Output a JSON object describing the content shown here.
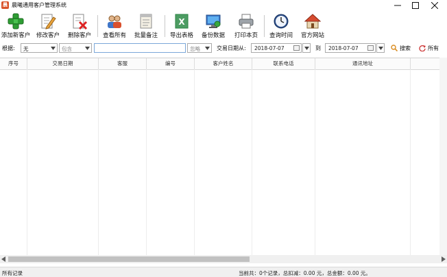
{
  "window": {
    "title": "晨曦通用客户管理系统",
    "app_icon_glyph": "晨"
  },
  "toolbar": {
    "add_customer": "添加新客户",
    "edit_customer": "修改客户",
    "delete_customer": "删除客户",
    "view_all": "查看所有",
    "batch_note": "批量备注",
    "export_table": "导出表格",
    "backup_data": "备份数据",
    "print_page": "打印本页",
    "check_time": "查询时间",
    "official_site": "官方网站"
  },
  "filter": {
    "basis_label": "根据:",
    "field_select_value": "无",
    "match_select_value": "包含",
    "keyword_value": "",
    "ignore_select_value": "忽略",
    "date_from_label": "交易日期从:",
    "date_from": "2018-07-07",
    "to_label": "到",
    "date_to": "2018-07-07",
    "search_button": "搜索",
    "all_button": "所有"
  },
  "table": {
    "columns": [
      "序号",
      "交易日期",
      "客服",
      "编号",
      "客户姓名",
      "联系电话",
      "通讯地址"
    ],
    "rows": []
  },
  "status": {
    "left": "所有记录",
    "right": "当前共：0个记录，总扣减：0.00 元，总金额：0.00 元。"
  },
  "colors": {
    "accent": "#2f7d32",
    "selection_border": "#7aa7d8"
  }
}
